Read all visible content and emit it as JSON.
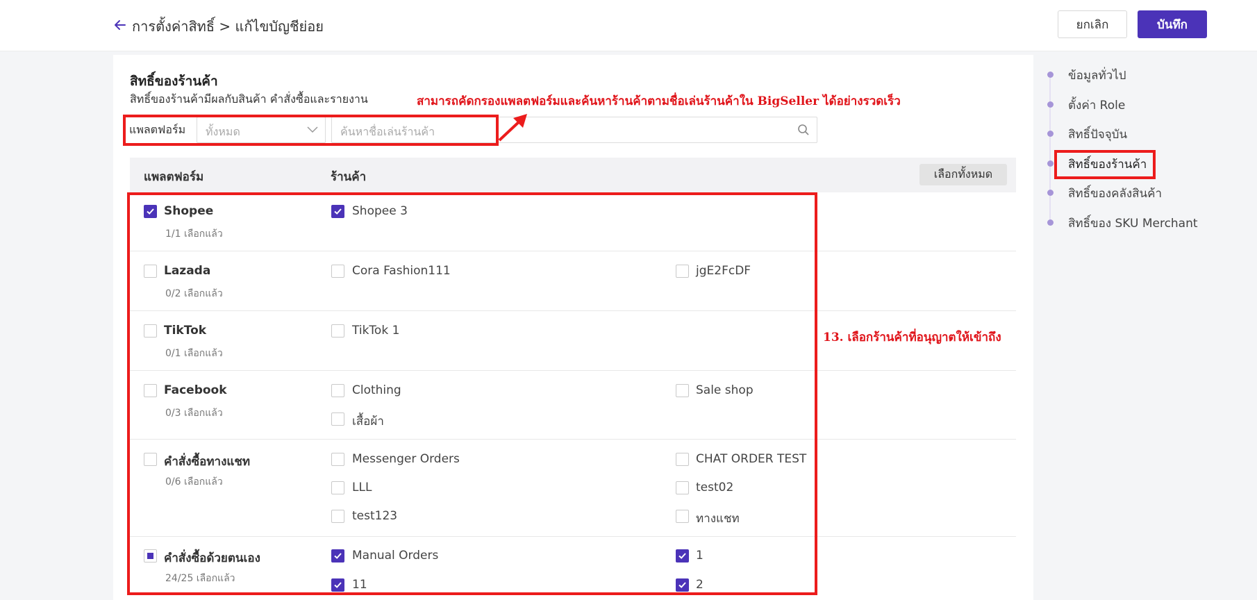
{
  "header": {
    "breadcrumb": "การตั้งค่าสิทธิ์ > แก้ไขบัญชีย่อย",
    "cancel_label": "ยกเลิก",
    "save_label": "บันทึก"
  },
  "section": {
    "title": "สิทธิ์ของร้านค้า",
    "description": "สิทธิ์ของร้านค้ามีผลกับสินค้า คำสั่งซื้อและรายงาน"
  },
  "annotations": {
    "filter_note": "สามารถคัดกรองแพลตฟอร์มและค้นหาร้านค้าตามชื่อเล่นร้านค้าใน BigSeller ได้อย่างรวดเร็ว",
    "select_note": "13. เลือกร้านค้าที่อนุญาตให้เข้าถึง"
  },
  "filter": {
    "label": "แพลตฟอร์ม",
    "select_placeholder": "ทั้งหมด",
    "search_placeholder": "ค้นหาชื่อเล่นร้านค้า"
  },
  "table": {
    "col_platform": "แพลตฟอร์ม",
    "col_shop": "ร้านค้า",
    "select_all_label": "เลือกทั้งหมด",
    "rows": [
      {
        "platform": "Shopee",
        "count": "1/1 เลือกแล้ว",
        "state": "checked",
        "shops": [
          {
            "name": "Shopee 3",
            "checked": true
          }
        ]
      },
      {
        "platform": "Lazada",
        "count": "0/2 เลือกแล้ว",
        "state": "unchecked",
        "shops": [
          {
            "name": "Cora Fashion111",
            "checked": false
          },
          {
            "name": "jgE2FcDF",
            "checked": false
          }
        ]
      },
      {
        "platform": "TikTok",
        "count": "0/1 เลือกแล้ว",
        "state": "unchecked",
        "shops": [
          {
            "name": "TikTok 1",
            "checked": false
          }
        ]
      },
      {
        "platform": "Facebook",
        "count": "0/3 เลือกแล้ว",
        "state": "unchecked",
        "shops": [
          {
            "name": "Clothing",
            "checked": false
          },
          {
            "name": "Sale shop",
            "checked": false
          },
          {
            "name": "เสื้อผ้า",
            "checked": false
          }
        ]
      },
      {
        "platform": "คำสั่งซื้อทางแชท",
        "count": "0/6 เลือกแล้ว",
        "state": "unchecked",
        "shops": [
          {
            "name": "Messenger Orders",
            "checked": false
          },
          {
            "name": "CHAT ORDER TEST",
            "checked": false
          },
          {
            "name": "LLL",
            "checked": false
          },
          {
            "name": "test02",
            "checked": false
          },
          {
            "name": "test123",
            "checked": false
          },
          {
            "name": "ทางแชท",
            "checked": false
          }
        ]
      },
      {
        "platform": "คำสั่งซื้อด้วยตนเอง",
        "count": "24/25 เลือกแล้ว",
        "state": "partial",
        "shops": [
          {
            "name": "Manual Orders",
            "checked": true
          },
          {
            "name": "1",
            "checked": true
          },
          {
            "name": "11",
            "checked": true
          },
          {
            "name": "2",
            "checked": true
          }
        ]
      }
    ]
  },
  "side_nav": {
    "items": [
      "ข้อมูลทั่วไป",
      "ตั้งค่า Role",
      "สิทธิ์ปัจจุบัน",
      "สิทธิ์ของร้านค้า",
      "สิทธิ์ของคลังสินค้า",
      "สิทธิ์ของ SKU Merchant"
    ],
    "active_index": 3
  },
  "colors": {
    "accent": "#4b33b8",
    "annotation_red": "#e0141a",
    "nav_dot": "#a695d8"
  },
  "icons": {
    "back": "arrow-left-icon",
    "dropdown": "chevron-down-icon",
    "search": "search-icon",
    "check": "check-icon"
  }
}
